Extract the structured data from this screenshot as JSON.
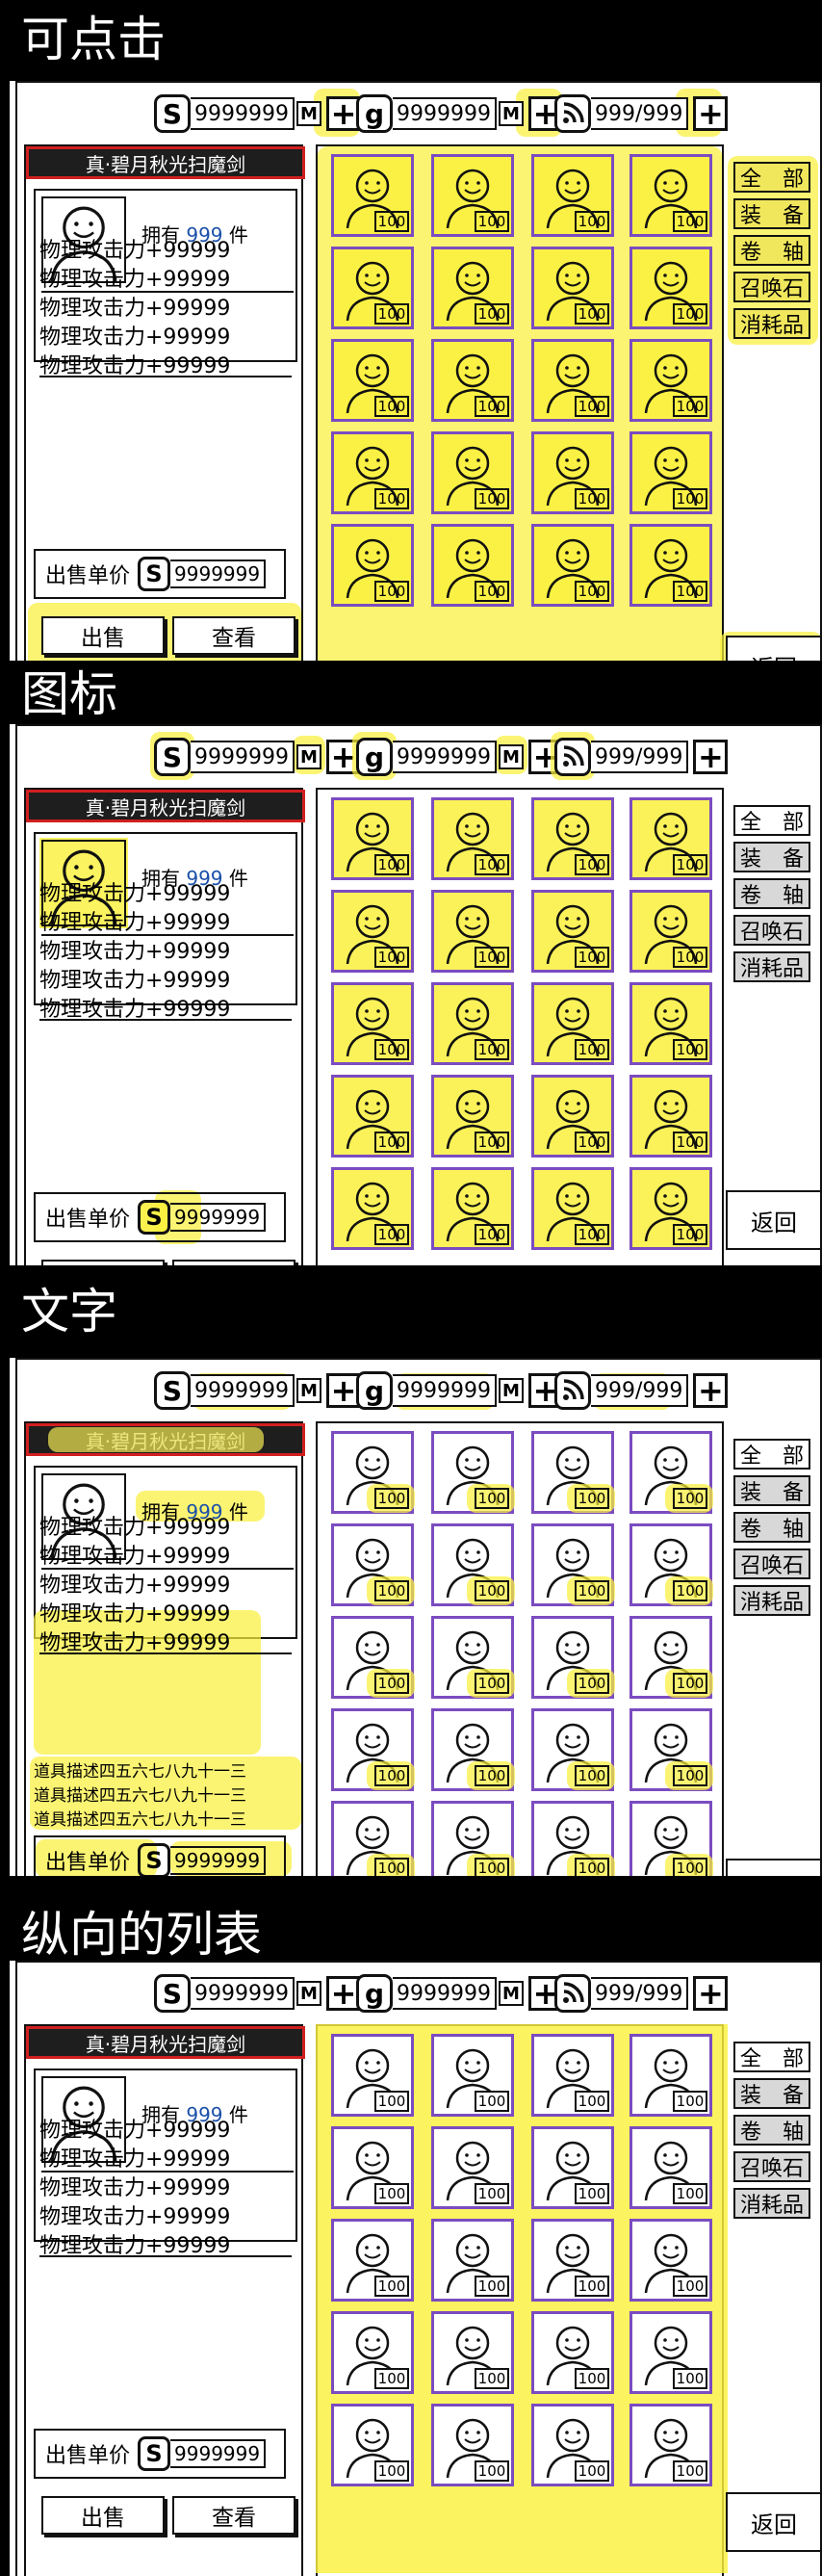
{
  "sections": [
    {
      "title": "可点击",
      "mode": "clickable"
    },
    {
      "title": "图标",
      "mode": "icons"
    },
    {
      "title": "文字",
      "mode": "text"
    },
    {
      "title": "纵向的列表",
      "mode": "list"
    }
  ],
  "resources": [
    {
      "icon": "coin-s-icon",
      "glyph": "S",
      "value": "9999999",
      "extra": "M"
    },
    {
      "icon": "gem-g-icon",
      "glyph": "g",
      "value": "9999999",
      "extra": "M"
    },
    {
      "icon": "energy-icon",
      "glyph": "",
      "value": "999/999",
      "extra": ""
    }
  ],
  "plus_label": "+",
  "item": {
    "name": "真·碧月秋光扫魔剑",
    "own_prefix": "拥有",
    "own_count": "999",
    "own_suffix": "件",
    "stats": [
      "物理攻击力+99999",
      "物理攻击力+99999",
      "物理攻击力+99999",
      "物理攻击力+99999",
      "物理攻击力+99999"
    ],
    "description": [
      "道具描述四五六七八九十一三",
      "道具描述四五六七八九十一三",
      "道具描述四五六七八九十一三"
    ],
    "price_label": "出售单价",
    "price_value": "9999999"
  },
  "buttons": {
    "sell": "出售",
    "view": "查看",
    "back": "返回"
  },
  "tabs": [
    {
      "label": "全　部",
      "shade": false
    },
    {
      "label": "装　备",
      "shade": true
    },
    {
      "label": "卷　轴",
      "shade": true
    },
    {
      "label": "召唤石",
      "shade": true
    },
    {
      "label": "消耗品",
      "shade": true
    }
  ],
  "grid": {
    "rows": 5,
    "cols": 4,
    "level": "100"
  },
  "colors": {
    "highlight": "#faf03c",
    "title_border": "#d01f1f",
    "cell_border": "#7b4cc0",
    "count_blue": "#1a4fa8"
  }
}
